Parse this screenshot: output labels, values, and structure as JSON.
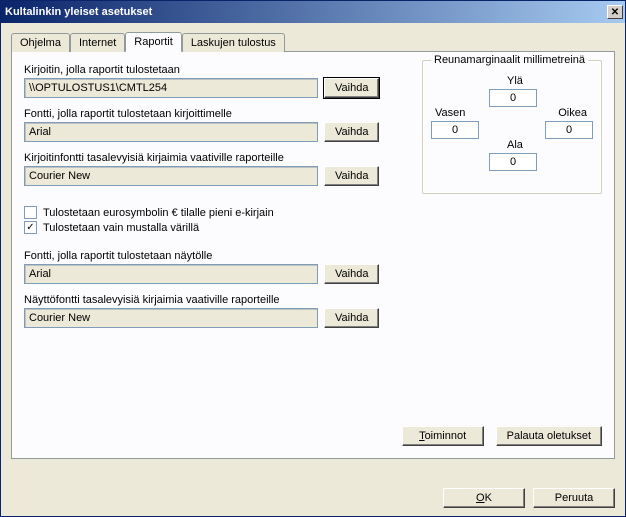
{
  "window": {
    "title": "Kultalinkin yleiset asetukset"
  },
  "tabs": {
    "t0": "Ohjelma",
    "t1": "Internet",
    "t2": "Raportit",
    "t3": "Laskujen tulostus"
  },
  "labels": {
    "printer": "Kirjoitin, jolla raportit tulostetaan",
    "printerFont": "Fontti, jolla raportit tulostetaan kirjoittimelle",
    "printerMono": "Kirjoitinfontti tasalevyisiä kirjaimia vaativille raporteille",
    "euro": "Tulostetaan eurosymbolin € tilalle pieni e-kirjain",
    "blackOnly": "Tulostetaan vain mustalla värillä",
    "screenFont": "Fontti, jolla raportit tulostetaan näytölle",
    "screenMono": "Näyttöfontti tasalevyisiä kirjaimia vaativille raporteille",
    "group": "Reunamarginaalit millimetreinä",
    "top": "Ylä",
    "left": "Vasen",
    "right": "Oikea",
    "bottom": "Ala"
  },
  "values": {
    "printer": "\\\\OPTULOSTUS1\\CMTL254",
    "printerFont": "Arial",
    "printerMono": "Courier New",
    "screenFont": "Arial",
    "screenMono": "Courier New",
    "marginTop": "0",
    "marginLeft": "0",
    "marginRight": "0",
    "marginBottom": "0",
    "euroChecked": false,
    "blackChecked": true
  },
  "buttons": {
    "change": "Vaihda",
    "actions_pre": "T",
    "actions_post": "oiminnot",
    "restore": "Palauta oletukset",
    "ok_pre": "O",
    "ok_post": "K",
    "cancel": "Peruuta"
  }
}
